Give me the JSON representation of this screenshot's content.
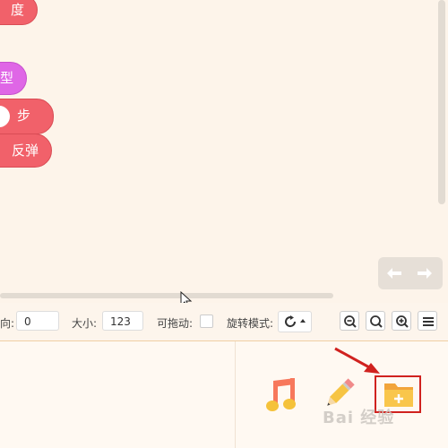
{
  "blocks": {
    "b1": "度",
    "b2": "型",
    "b3": "步",
    "b4": "反弹"
  },
  "toolbar": {
    "direction_label": "向:",
    "direction_value": "0",
    "size_label": "大小:",
    "size_value": "123",
    "draggable_label": "可拖动:",
    "rotation_label": "旋转模式:"
  },
  "icons": {
    "undo": "undo-arrow-icon",
    "redo": "redo-arrow-icon",
    "zoom_out": "zoom-out-icon",
    "zoom_reset": "zoom-reset-icon",
    "zoom_in": "zoom-in-icon",
    "menu": "hamburger-menu-icon",
    "music": "music-note-icon",
    "pencil": "pencil-icon",
    "folder_add": "folder-add-icon"
  },
  "colors": {
    "block_red": "#f1616a",
    "block_purple": "#df66e6",
    "highlight": "#d0221f"
  },
  "watermark": "Bai 经验"
}
